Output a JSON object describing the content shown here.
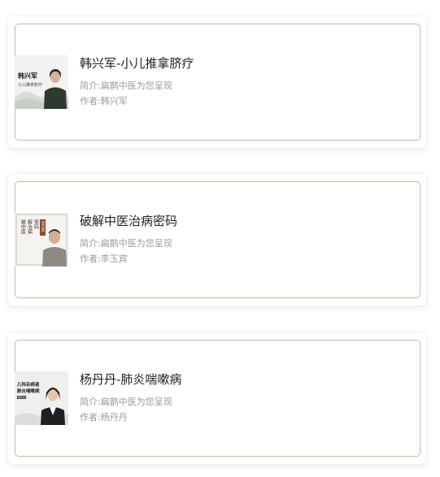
{
  "courses": [
    {
      "title": "韩兴军-小儿推拿脐疗",
      "intro": "简介:扁鹊中医为您呈现",
      "author": "作者:韩兴军",
      "thumb_title": "韩兴军",
      "thumb_subtitle": "小儿推拿脐疗"
    },
    {
      "title": "破解中医治病密码",
      "intro": "简介:扁鹊中医为您呈现",
      "author": "作者:李玉宾",
      "thumb_cols": [
        "破中医",
        "解治病",
        "密码"
      ],
      "thumb_seal": "李玉宾"
    },
    {
      "title": "杨丹丹-肺炎喘嗽病",
      "intro": "简介:扁鹊中医为您呈现",
      "author": "作者:杨丹丹",
      "thumb_line1": "儿科杂病者",
      "thumb_line2": "肺炎喘嗽病",
      "thumb_name": "杨丹丹"
    }
  ],
  "colors": {
    "frame": "#cdb89a",
    "title": "#222222",
    "meta": "#9a9a9a"
  }
}
